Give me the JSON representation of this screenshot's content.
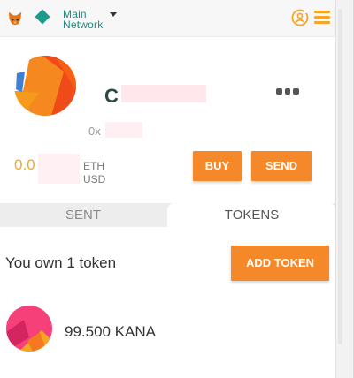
{
  "header": {
    "network": {
      "line1": "Main",
      "line2": "Network"
    },
    "icons": [
      "fox-icon",
      "network-diamond-icon",
      "chevron-down-icon",
      "account-switch-icon",
      "menu-icon"
    ]
  },
  "account": {
    "name_visible": "C",
    "address_visible": "0x",
    "balance": {
      "value_visible": "0.0",
      "eth_unit": "ETH",
      "usd_unit": "USD"
    }
  },
  "actions": {
    "buy": "BUY",
    "send": "SEND"
  },
  "tabs": [
    {
      "label": "SENT",
      "active": false
    },
    {
      "label": "TOKENS",
      "active": true
    }
  ],
  "tokens": {
    "summary": "You own 1 token",
    "add_label": "ADD TOKEN",
    "items": [
      {
        "balance": "99.500 KANA"
      }
    ]
  },
  "colors": {
    "accent": "#f5892a",
    "network": "#1c9b8a",
    "balance": "#f5a623"
  }
}
